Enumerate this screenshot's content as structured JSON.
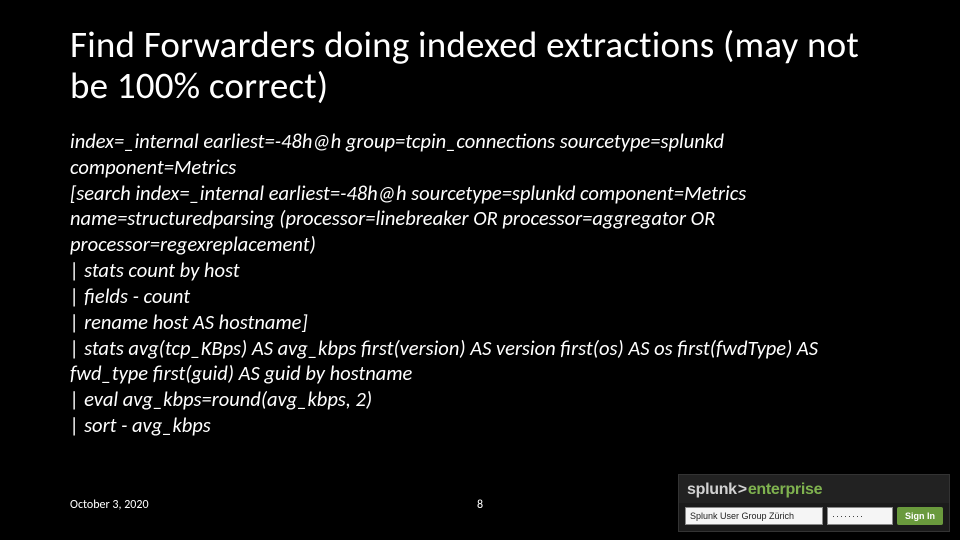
{
  "title": "Find Forwarders doing indexed extractions (may not be 100% correct)",
  "query": {
    "l1": "index=_internal earliest=-48h@h group=tcpin_connections sourcetype=splunkd component=Metrics",
    "l2": "[search index=_internal earliest=-48h@h sourcetype=splunkd component=Metrics name=structuredparsing (processor=linebreaker OR processor=aggregator OR processor=regexreplacement)",
    "l3": "| stats count by host",
    "l4": "| fields - count",
    "l5": "| rename host AS hostname]",
    "l6": "| stats avg(tcp_KBps) AS avg_kbps first(version) AS version first(os) AS os first(fwdType) AS fwd_type first(guid) AS guid by hostname",
    "l7": "| eval avg_kbps=round(avg_kbps, 2)",
    "l8": "| sort - avg_kbps"
  },
  "footer": {
    "date": "October 3, 2020",
    "page": "8"
  },
  "splunk": {
    "brand_a": "splunk",
    "brand_gt": ">",
    "brand_b": "enterprise",
    "user": "Splunk User Group Zürich",
    "pw": "········",
    "signin": "Sign In"
  }
}
